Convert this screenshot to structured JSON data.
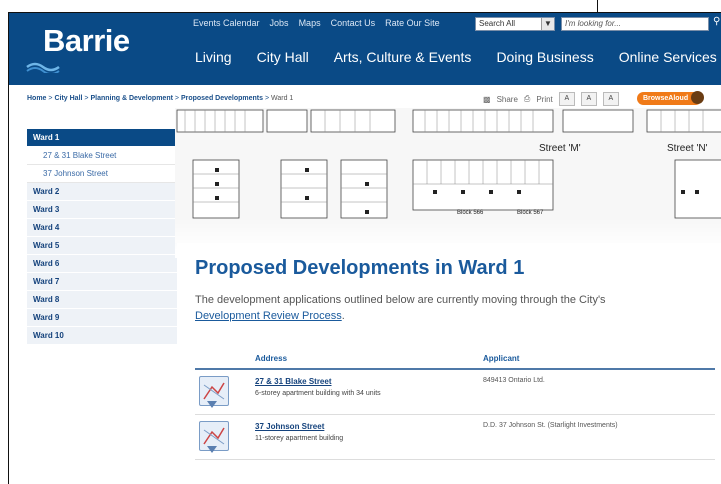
{
  "site": {
    "logo": "Barrie"
  },
  "utility_nav": [
    "Events Calendar",
    "Jobs",
    "Maps",
    "Contact Us",
    "Rate Our Site"
  ],
  "search": {
    "scope": "Search All",
    "placeholder": "I'm looking for..."
  },
  "main_nav": [
    "Living",
    "City Hall",
    "Arts, Culture & Events",
    "Doing Business",
    "Online Services"
  ],
  "breadcrumb": {
    "items": [
      "Home",
      "City Hall",
      "Planning & Development",
      "Proposed Developments"
    ],
    "current": "Ward 1",
    "separator": ">"
  },
  "tools": {
    "share": "Share",
    "print": "Print",
    "font_sizes": [
      "A",
      "A",
      "A"
    ],
    "browse": "BrowseAloud"
  },
  "sidebar": {
    "items": [
      {
        "label": "Ward 1",
        "active": true,
        "children": [
          "27 & 31 Blake Street",
          "37 Johnson Street"
        ]
      },
      {
        "label": "Ward 2"
      },
      {
        "label": "Ward 3"
      },
      {
        "label": "Ward 4"
      },
      {
        "label": "Ward 5"
      },
      {
        "label": "Ward 6"
      },
      {
        "label": "Ward 7"
      },
      {
        "label": "Ward 8"
      },
      {
        "label": "Ward 9"
      },
      {
        "label": "Ward 10"
      }
    ]
  },
  "map": {
    "street_m": "Street 'M'",
    "street_n": "Street 'N'",
    "block_a": "Block 566",
    "block_b": "Block 567"
  },
  "page": {
    "title": "Proposed Developments in Ward 1",
    "intro_before": "The development applications outlined below are currently moving through the City's ",
    "intro_link": "Development Review Process",
    "intro_after": "."
  },
  "table": {
    "headers": {
      "address": "Address",
      "applicant": "Applicant"
    },
    "rows": [
      {
        "address": "27 & 31 Blake Street",
        "description": "6-storey apartment building with 34 units",
        "applicant": "849413 Ontario Ltd."
      },
      {
        "address": "37 Johnson Street",
        "description": "11-storey apartment building",
        "applicant": "D.D. 37 Johnson St. (Starlight Investments)"
      }
    ]
  },
  "colors": {
    "header_bg": "#0a4a86",
    "accent": "#1a5a9c",
    "browse": "#f07a18"
  }
}
